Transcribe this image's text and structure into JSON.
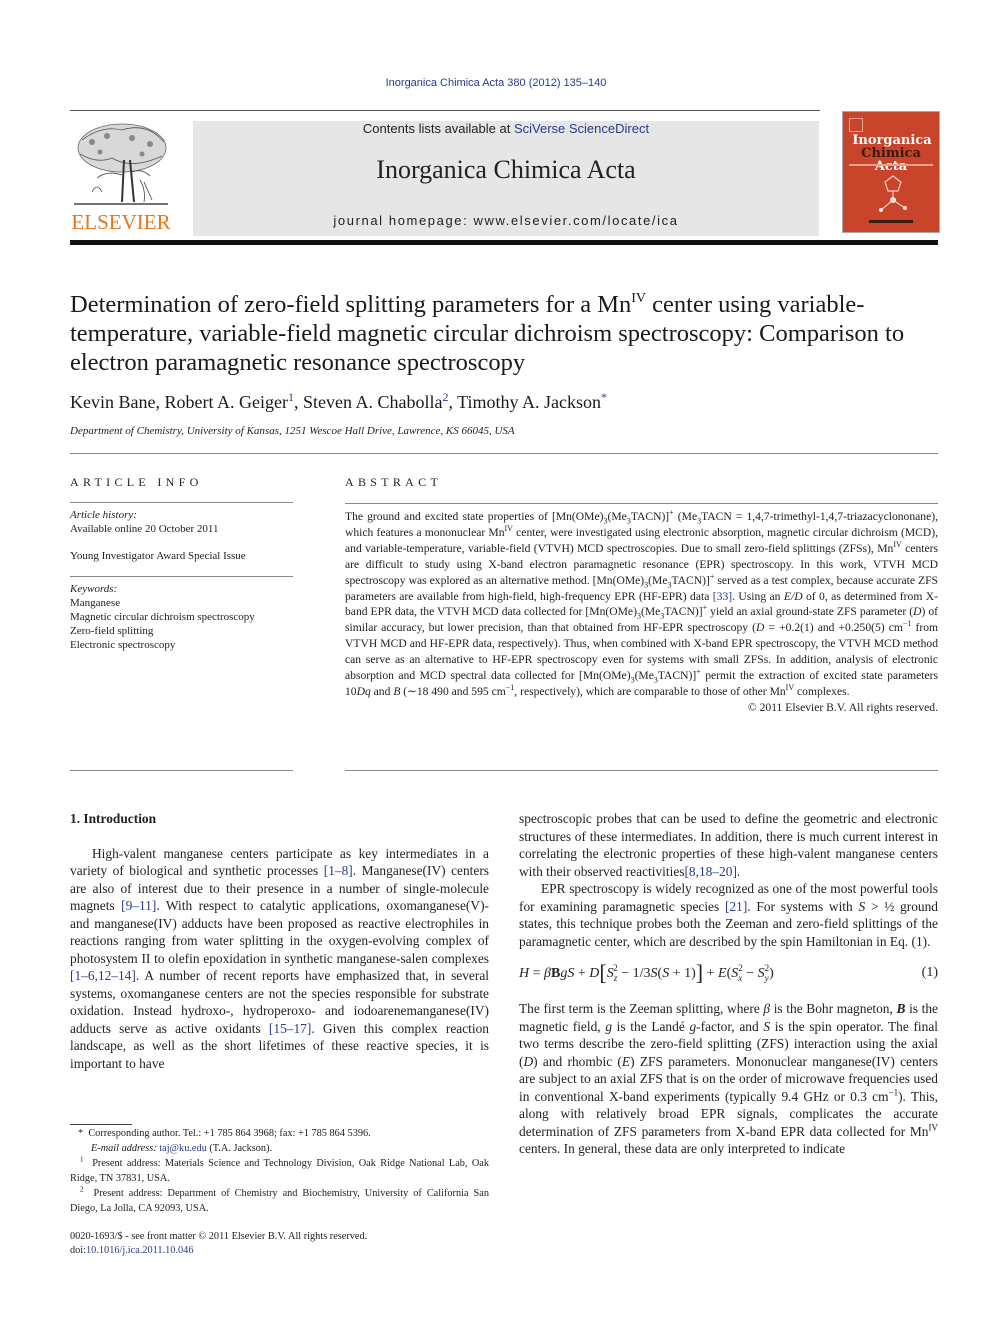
{
  "header": {
    "citation": "Inorganica Chimica Acta 380 (2012) 135–140",
    "contents_prefix": "Contents lists available at ",
    "contents_link": "SciVerse ScienceDirect",
    "journal_title": "Inorganica Chimica Acta",
    "homepage": "journal homepage: www.elsevier.com/locate/ica",
    "publisher_logo_text": "ELSEVIER",
    "cover": {
      "line1": "Inorganica",
      "line2a": "Chimica",
      "line2b": "Acta"
    }
  },
  "colors": {
    "link": "#2a3a8c",
    "elsevier_orange": "#e8741a",
    "cover_red": "#c8442a",
    "masthead_gray": "#e6e6e6"
  },
  "article": {
    "title_part1": "Determination of zero-field splitting parameters for a Mn",
    "title_sup": "IV",
    "title_part2": " center using variable-temperature, variable-field magnetic circular dichroism spectroscopy: Comparison to electron paramagnetic resonance spectroscopy",
    "authors": [
      {
        "name": "Kevin Bane",
        "mark": ""
      },
      {
        "name": "Robert A. Geiger",
        "mark": "1"
      },
      {
        "name": "Steven A. Chabolla",
        "mark": "2"
      },
      {
        "name": "Timothy A. Jackson",
        "mark": "*"
      }
    ],
    "affiliation": "Department of Chemistry, University of Kansas, 1251 Wescoe Hall Drive, Lawrence, KS 66045, USA"
  },
  "article_info": {
    "heading": "ARTICLE INFO",
    "history_label": "Article history:",
    "history_value": "Available online 20 October 2011",
    "special_issue": "Young Investigator Award Special Issue",
    "keywords_label": "Keywords:",
    "keywords": [
      "Manganese",
      "Magnetic circular dichroism spectroscopy",
      "Zero-field splitting",
      "Electronic spectroscopy"
    ]
  },
  "abstract": {
    "heading": "ABSTRACT",
    "s1": "The ground and excited state properties of [Mn(OMe)",
    "s2": "(Me",
    "s3": "TACN)]",
    "s4": " (Me",
    "s5": "TACN = 1,4,7-trimethyl-1,4,7-triazacyclononane), which features a mononuclear Mn",
    "s6": " center, were investigated using electronic absorption, magnetic circular dichroism (MCD), and variable-temperature, variable-field (VTVH) MCD spectroscopies. Due to small zero-field splittings (ZFSs), Mn",
    "s7": " centers are difficult to study using X-band electron paramagnetic resonance (EPR) spectroscopy. In this work, VTVH MCD spectroscopy was explored as an alternative method. [Mn(OMe)",
    "s8": " served as a test complex, because accurate ZFS parameters are available from high-field, high-frequency EPR (HF-EPR) data ",
    "ref33": "[33]",
    "s9": ". Using an ",
    "ED": "E/D",
    "s10": " of 0, as determined from X-band EPR data, the VTVH MCD data collected for [Mn(OMe)",
    "s11": " yield an axial ground-state ZFS parameter (",
    "D": "D",
    "s12": ") of similar accuracy, but lower precision, than that obtained from HF-EPR spectroscopy (",
    "s13": " = +0.2(1) and +0.250(5) cm",
    "s14": " from VTVH MCD and HF-EPR data, respectively). Thus, when combined with X-band EPR spectroscopy, the VTVH MCD method can serve as an alternative to HF-EPR spectroscopy even for systems with small ZFSs. In addition, analysis of electronic absorption and MCD spectral data collected for [Mn(OMe)",
    "s15": " permit the extraction of excited state parameters 10",
    "Dq": "Dq",
    "s16": " and ",
    "B": "B",
    "s17": " (∼18 490 and 595 cm",
    "s18": ", respectively), which are comparable to those of other Mn",
    "s19": " complexes.",
    "sub3": "3",
    "sup_plus": "+",
    "sup_iv": "IV",
    "sup_m1": "−1",
    "copyright": "© 2011 Elsevier B.V. All rights reserved."
  },
  "intro": {
    "heading": "1. Introduction",
    "p1_a": "High-valent manganese centers participate as key intermediates in a variety of biological and synthetic processes ",
    "ref_1_8": "[1–8]",
    "p1_b": ". Manganese(IV) centers are also of interest due to their presence in a number of single-molecule magnets ",
    "ref_9_11": "[9–11]",
    "p1_c": ". With respect to catalytic applications, oxomanganese(V)- and manganese(IV) adducts have been proposed as reactive electrophiles in reactions ranging from water splitting in the oxygen-evolving complex of photosystem II to olefin epoxidation in synthetic manganese-salen complexes ",
    "ref_1_6_12_14": "[1–6,12–14]",
    "p1_d": ". A number of recent reports have emphasized that, in several systems, oxomanganese centers are not the species responsible for substrate oxidation. Instead hydroxo-, hydroperoxo- and iodoarenemanganese(IV) adducts serve as active oxidants ",
    "ref_15_17": "[15–17]",
    "p1_e": ". Given this complex reaction landscape, as well as the short lifetimes of these reactive species, it is important to have spectroscopic probes that can be used to define the geometric and electronic structures of these intermediates. In addition, there is much current interest in correlating the electronic properties of these high-valent manganese centers with their observed reactivities ",
    "ref_8_18_20": "[8,18–20]",
    "p1_f": ".",
    "p2_a": "EPR spectroscopy is widely recognized as one of the most powerful tools for examining paramagnetic species ",
    "ref_21": "[21]",
    "p2_b": ". For systems with ",
    "p2_S": "S",
    "p2_c": " > ½ ground states, this technique probes both the Zeeman and zero-field splittings of the paramagnetic center, which are described by the spin Hamiltonian in Eq. (1).",
    "equation_number": "(1)",
    "p3_a": "The first term is the Zeeman splitting, where ",
    "beta": "β",
    "p3_b": " is the Bohr magneton, ",
    "Bbold": "B",
    "p3_c": " is the magnetic field, ",
    "g": "g",
    "p3_d": " is the Landé ",
    "p3_e": "-factor, and ",
    "S": "S",
    "p3_f": " is the spin operator. The final two terms describe the zero-field splitting (ZFS) interaction using the axial (",
    "D": "D",
    "p3_g": ") and rhombic (",
    "E": "E",
    "p3_h": ") ZFS parameters. Mononuclear manganese(IV) centers are subject to an axial ZFS that is on the order of microwave frequencies used in conventional X-band experiments (typically 9.4 GHz or 0.3 cm",
    "sup_m1": "−1",
    "p3_i": "). This, along with relatively broad EPR signals, complicates the accurate determination of ZFS parameters from X-band EPR data collected for Mn",
    "sup_iv": "IV",
    "p3_j": " centers. In general, these data are only interpreted to indicate"
  },
  "footnotes": {
    "corr_mark": "*",
    "corr": "Corresponding author. Tel.: +1 785 864 3968; fax: +1 785 864 5396.",
    "email_label": "E-mail address:",
    "email": "taj@ku.edu",
    "email_suffix": " (T.A. Jackson).",
    "fn1_mark": "1",
    "fn1": "Present address: Materials Science and Technology Division, Oak Ridge National Lab, Oak Ridge, TN 37831, USA.",
    "fn2_mark": "2",
    "fn2": "Present address: Department of Chemistry and Biochemistry, University of California San Diego, La Jolla, CA 92093, USA.",
    "issn": "0020-1693/$ - see front matter © 2011 Elsevier B.V. All rights reserved.",
    "doi_label": "doi:",
    "doi": "10.1016/j.ica.2011.10.046"
  }
}
